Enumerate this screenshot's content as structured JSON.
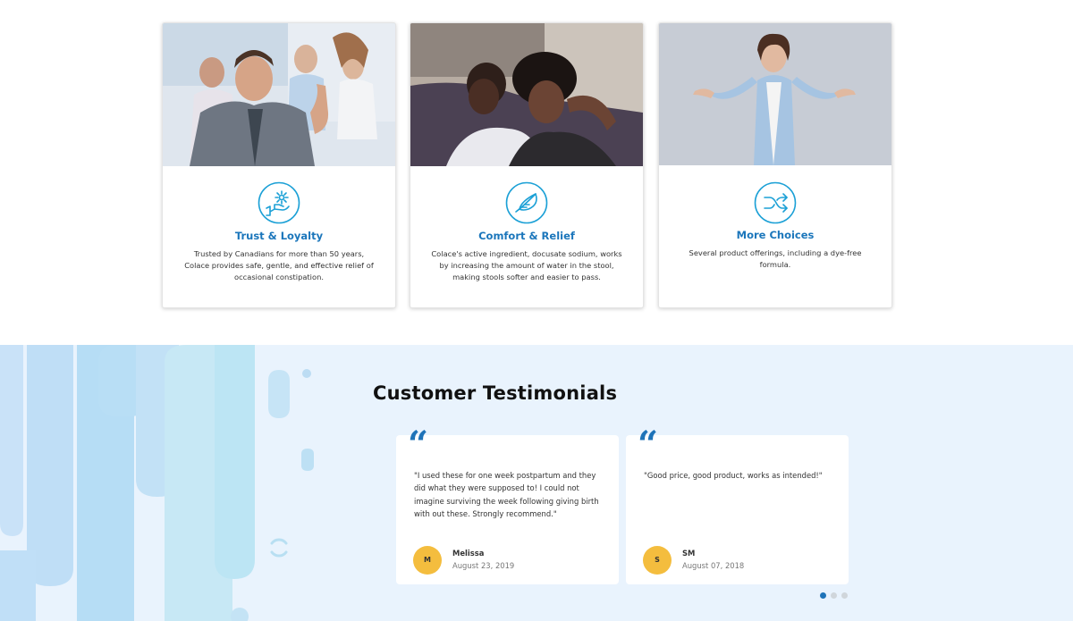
{
  "features": {
    "cards": [
      {
        "image": "people-thumbs-up-photo",
        "icon": "hand-sparkle-icon",
        "title": "Trust & Loyalty",
        "text": "Trusted by Canadians for more than 50 years, Colace provides safe, gentle, and effective relief of occasional constipation."
      },
      {
        "image": "relaxing-couple-photo",
        "icon": "feather-icon",
        "title": "Comfort & Relief",
        "text": "Colace's active ingredient, docusate sodium, works by increasing the amount of water in the stool, making stools softer and easier to pass."
      },
      {
        "image": "woman-open-hands-photo",
        "icon": "shuffle-arrows-icon",
        "title": "More Choices",
        "text": "Several product offerings, including a dye-free formula."
      }
    ]
  },
  "testimonials": {
    "heading": "Customer Testimonials",
    "quote_icon": "quote-icon",
    "items": [
      {
        "text": "\"I used these for one week postpartum and they did what they were supposed to! I could not imagine surviving the week following giving birth with out these. Strongly recommend.\"",
        "initials": "M",
        "name": "Melissa",
        "date": "August 23, 2019"
      },
      {
        "text": "\"Good price, good product, works as intended!\"",
        "initials": "S",
        "name": "SM",
        "date": "August 07, 2018"
      }
    ],
    "pagination": {
      "total": 3,
      "active": 1
    }
  },
  "colors": {
    "accent_blue": "#1b76bb",
    "section_bg": "#e9f3fd",
    "avatar_bg": "#f4bd3e",
    "dot_active": "#1e73b8",
    "dot_inactive": "#d0d6db"
  }
}
